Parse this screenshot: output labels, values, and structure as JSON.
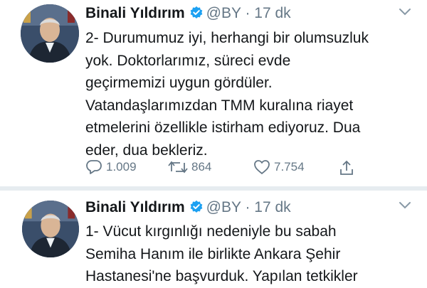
{
  "tweets": [
    {
      "author": "Binali Yıldırım",
      "handle": "@BY",
      "separator": "·",
      "time": "17 dk",
      "lines": [
        "2- Durumumuz iyi, herhangi bir olumsuzluk",
        "yok. Doktorlarımız, süreci evde",
        "geçirmemizi uygun gördüler.",
        "Vatandaşlarımızdan TMM kuralına riayet",
        "etmelerini özellikle istirham ediyoruz. Dua",
        "eder, dua bekleriz."
      ],
      "replies": "1.009",
      "retweets": "864",
      "likes": "7.754"
    },
    {
      "author": "Binali Yıldırım",
      "handle": "@BY",
      "separator": "·",
      "time": "17 dk",
      "lines": [
        "1- Vücut kırgınlığı nedeniyle bu sabah",
        "Semiha Hanım ile birlikte Ankara Şehir",
        "Hastanesi'ne başvurduk. Yapılan tetkikler"
      ]
    }
  ],
  "colors": {
    "verified": "#1da1f2",
    "muted": "#657786",
    "separator": "#e6ecf0"
  },
  "icons": [
    "verified-badge-icon",
    "chevron-down-icon",
    "reply-icon",
    "retweet-icon",
    "like-icon",
    "share-icon"
  ]
}
